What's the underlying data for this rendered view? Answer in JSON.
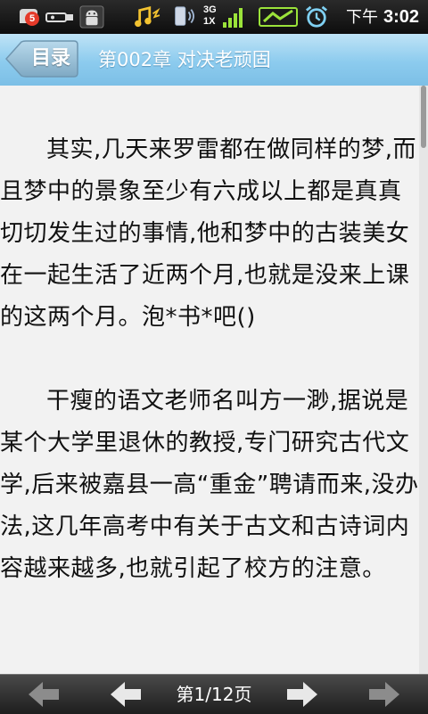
{
  "status_bar": {
    "notification_count": "5",
    "time_period": "下午",
    "time": "3:02",
    "icons": [
      "notification-icon",
      "usb-icon",
      "android-debug-icon",
      "music-icon",
      "vibrate-icon",
      "3g-signal-icon",
      "wifi-icon",
      "alarm-icon"
    ],
    "network_label_top": "3G",
    "network_label_bottom": "1X"
  },
  "header": {
    "back_label": "目录",
    "chapter_title": "第002章 对决老顽固"
  },
  "content": {
    "paragraphs": [
      "其实,几天来罗雷都在做同样的梦,而且梦中的景象至少有六成以上都是真真切切发生过的事情,他和梦中的古装美女在一起生活了近两个月,也就是没来上课的这两个月。泡*书*吧()",
      "干瘦的语文老师名叫方一渺,据说是某个大学里退休的教授,专门研究古代文学,后来被嘉县一高“重金”聘请而来,没办法,这几年高考中有关于古文和古诗词内容越来越多,也就引起了校方的注意。"
    ]
  },
  "footer": {
    "page_indicator": "第1/12页",
    "icons": [
      "first-page-icon",
      "prev-page-icon",
      "next-page-icon",
      "last-page-icon"
    ]
  },
  "colors": {
    "title_bar": "#8ccbee",
    "text": "#111111",
    "page_background": "#f2f2f2",
    "bottom_bar": "#2a2a2a"
  }
}
